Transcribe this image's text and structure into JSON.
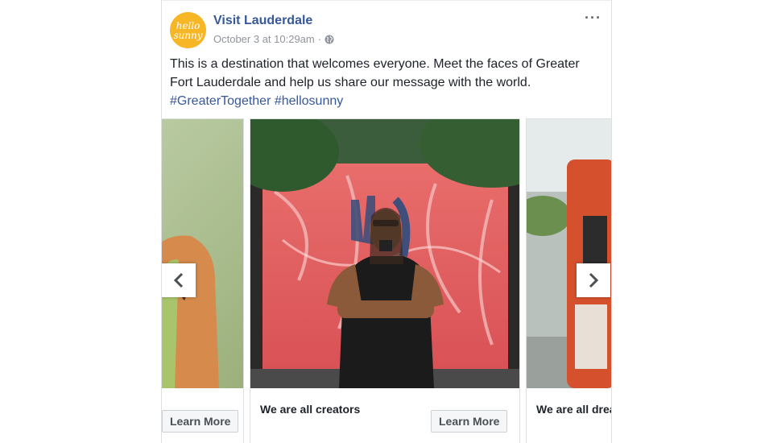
{
  "post": {
    "page_name": "Visit Lauderdale",
    "timestamp": "October 3 at 10:29am",
    "separator": "·",
    "avatar_line1": "hello",
    "avatar_line2": "sunny",
    "more_label": "···",
    "body_text": "This is a destination that welcomes everyone. Meet the faces of Greater Fort Lauderdale and help us share our message with the world.",
    "hashtags": "#GreaterTogether #hellosunny"
  },
  "carousel": {
    "cards": [
      {
        "title": "",
        "button": "Learn More"
      },
      {
        "title": "We are all creators",
        "button": "Learn More"
      },
      {
        "title": "We are all drea"
      }
    ],
    "prev_icon": "chevron-left-icon",
    "next_icon": "chevron-right-icon"
  },
  "colors": {
    "link": "#365899",
    "avatar": "#f7b626",
    "meta": "#90949c"
  }
}
